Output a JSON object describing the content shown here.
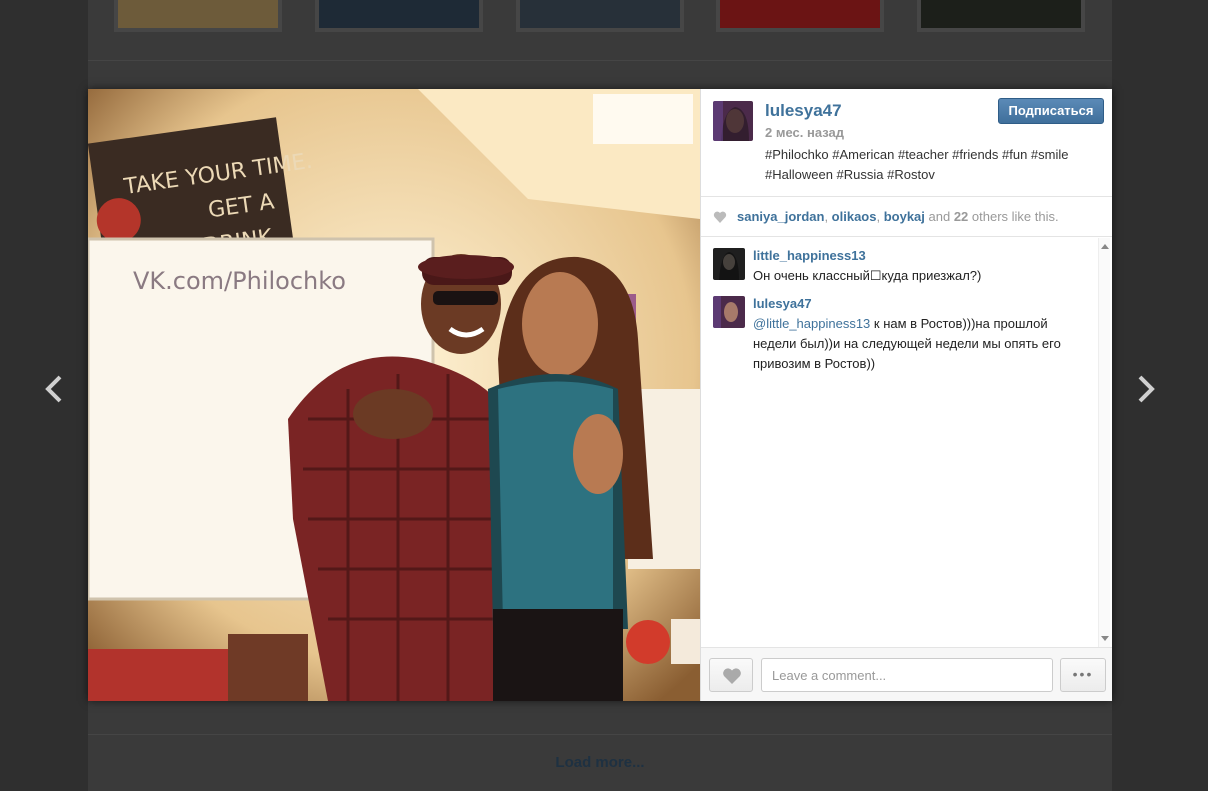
{
  "post": {
    "username": "lulesya47",
    "time_ago": "2 мес. назад",
    "caption": "#Philochko #American #teacher #friends #fun #smile #Halloween #Russia #Rostov",
    "follow_label": "Подписаться"
  },
  "likes": {
    "users": [
      "saniya_jordan",
      "olikaos",
      "boykaj"
    ],
    "sep1": ", ",
    "sep2": ", ",
    "and_text": " and ",
    "others_count": "22",
    "others_text": " others like this."
  },
  "comments": [
    {
      "username": "little_happiness13",
      "text": "Он очень классный☐куда приезжал?)"
    },
    {
      "username": "lulesya47",
      "mention": "@little_happiness13",
      "text": " к нам в Ростов)))на прошлой недели был))и на следующей недели мы опять его привозим в Ростов))"
    }
  ],
  "comment_box": {
    "placeholder": "Leave a comment...",
    "more_label": "•••"
  },
  "background": {
    "load_more": "Load more..."
  },
  "photo_text": {
    "board": "VK.com/Philochko",
    "poster_line1": "TAKE YOUR TIME.",
    "poster_line2": "GET A",
    "poster_line3": "DRINK"
  },
  "colors": {
    "link": "#3f729b",
    "follow_button": "#4a7cab"
  }
}
